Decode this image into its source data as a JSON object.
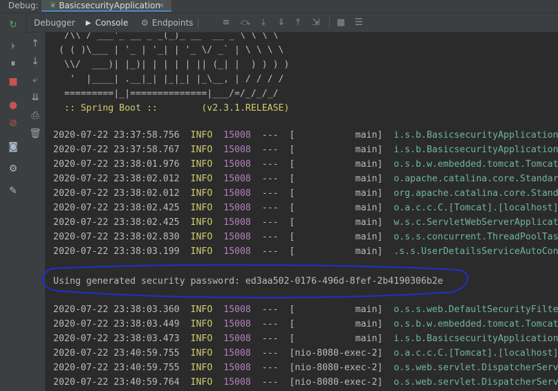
{
  "header": {
    "debug_label": "Debug:",
    "run_tab_title": "BasicsecurityApplication",
    "close_glyph": "×"
  },
  "toolbar": {
    "debugger_label": "Debugger",
    "console_label": "Console",
    "endpoints_label": "Endpoints"
  },
  "console": {
    "banner": [
      "  /\\\\ / ___'_ __ _ _(_)_ __  __ _ \\ \\ \\ \\",
      " ( ( )\\___ | '_ | '_| | '_ \\/ _` | \\ \\ \\ \\",
      "  \\\\/  ___)| |_)| | | | | || (_| |  ) ) ) )",
      "   '  |____| .__|_| |_|_| |_\\__, | / / / /",
      "  =========|_|==============|___/=/_/_/_/"
    ],
    "spring_line": "  :: Spring Boot ::        (v2.3.1.RELEASE)",
    "logs_before": [
      {
        "ts": "2020-07-22 23:37:58.756",
        "level": "INFO",
        "pid": "15008",
        "sep": "---",
        "thread": "[           main]",
        "logger": "i.s.b.BasicsecurityApplication"
      },
      {
        "ts": "2020-07-22 23:37:58.767",
        "level": "INFO",
        "pid": "15008",
        "sep": "---",
        "thread": "[           main]",
        "logger": "i.s.b.BasicsecurityApplication"
      },
      {
        "ts": "2020-07-22 23:38:01.976",
        "level": "INFO",
        "pid": "15008",
        "sep": "---",
        "thread": "[           main]",
        "logger": "o.s.b.w.embedded.tomcat.TomcatWebS"
      },
      {
        "ts": "2020-07-22 23:38:02.012",
        "level": "INFO",
        "pid": "15008",
        "sep": "---",
        "thread": "[           main]",
        "logger": "o.apache.catalina.core.StandardSer"
      },
      {
        "ts": "2020-07-22 23:38:02.012",
        "level": "INFO",
        "pid": "15008",
        "sep": "---",
        "thread": "[           main]",
        "logger": "org.apache.catalina.core.StandardE"
      },
      {
        "ts": "2020-07-22 23:38:02.425",
        "level": "INFO",
        "pid": "15008",
        "sep": "---",
        "thread": "[           main]",
        "logger": "o.a.c.c.C.[Tomcat].[localhost].[/"
      },
      {
        "ts": "2020-07-22 23:38:02.425",
        "level": "INFO",
        "pid": "15008",
        "sep": "---",
        "thread": "[           main]",
        "logger": "w.s.c.ServletWebServerApplicationC"
      },
      {
        "ts": "2020-07-22 23:38:02.830",
        "level": "INFO",
        "pid": "15008",
        "sep": "---",
        "thread": "[           main]",
        "logger": "o.s.s.concurrent.ThreadPoolTaskExe"
      },
      {
        "ts": "2020-07-22 23:38:03.199",
        "level": "INFO",
        "pid": "15008",
        "sep": "---",
        "thread": "[           main]",
        "logger": ".s.s.UserDetailsServiceAutoConfigu"
      }
    ],
    "password_line": "Using generated security password: ed3aa502-0176-496d-8fef-2b4190306b2e",
    "logs_after": [
      {
        "ts": "2020-07-22 23:38:03.360",
        "level": "INFO",
        "pid": "15008",
        "sep": "---",
        "thread": "[           main]",
        "logger": "o.s.s.web.DefaultSecurityFilterCha"
      },
      {
        "ts": "2020-07-22 23:38:03.449",
        "level": "INFO",
        "pid": "15008",
        "sep": "---",
        "thread": "[           main]",
        "logger": "o.s.b.w.embedded.tomcat.TomcatWebS"
      },
      {
        "ts": "2020-07-22 23:38:03.473",
        "level": "INFO",
        "pid": "15008",
        "sep": "---",
        "thread": "[           main]",
        "logger": "i.s.b.BasicsecurityApplication"
      },
      {
        "ts": "2020-07-22 23:40:59.755",
        "level": "INFO",
        "pid": "15008",
        "sep": "---",
        "thread": "[nio-8080-exec-2]",
        "logger": "o.a.c.c.C.[Tomcat].[localhost].[/"
      },
      {
        "ts": "2020-07-22 23:40:59.755",
        "level": "INFO",
        "pid": "15008",
        "sep": "---",
        "thread": "[nio-8080-exec-2]",
        "logger": "o.s.web.servlet.DispatcherServlet"
      },
      {
        "ts": "2020-07-22 23:40:59.764",
        "level": "INFO",
        "pid": "15008",
        "sep": "---",
        "thread": "[nio-8080-exec-2]",
        "logger": "o.s.web.servlet.DispatcherServlet"
      }
    ]
  },
  "colors": {
    "level": "#cfcc70",
    "pid": "#b580bf",
    "logger": "#6fb59b",
    "annotation": "#1f2fd0"
  }
}
